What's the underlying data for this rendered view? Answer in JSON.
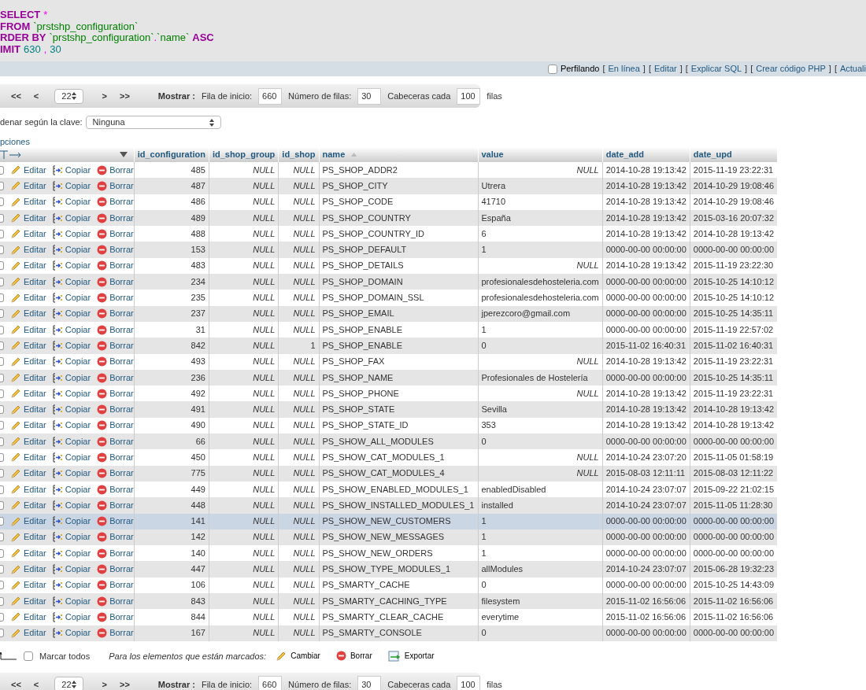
{
  "sql": {
    "lines": [
      [
        {
          "kind": "keyword",
          "text": "SELECT"
        },
        {
          "kind": "operator",
          "text": "*"
        }
      ],
      [
        {
          "kind": "keyword",
          "text": "FROM"
        },
        {
          "kind": "identifier",
          "text": "`prstshp_configuration`"
        }
      ],
      [
        {
          "kind": "keyword",
          "text": "RDER BY"
        },
        {
          "kind": "identifier",
          "text": "`prstshp_configuration`"
        },
        {
          "kind": "punct",
          "text": "."
        },
        {
          "kind": "identifier",
          "text": "`name`"
        },
        {
          "kind": "keyword",
          "text": "ASC"
        }
      ],
      [
        {
          "kind": "keyword",
          "text": "IMIT"
        },
        {
          "kind": "number",
          "text": "630"
        },
        {
          "kind": "operator",
          "text": ","
        },
        {
          "kind": "number",
          "text": "30"
        }
      ]
    ]
  },
  "profiling": {
    "checked": false,
    "label": "Perfilando",
    "bracket_open": "[",
    "bracket_close": "]",
    "links": [
      {
        "label": "En línea"
      },
      {
        "label": "Editar"
      },
      {
        "label": "Explicar SQL"
      },
      {
        "label": "Crear código PHP"
      },
      {
        "label": "Actuali"
      }
    ]
  },
  "nav_top": {
    "first": "<<",
    "prev": "<",
    "page": "22",
    "next": ">",
    "last": ">>",
    "show_label": "Mostrar :",
    "start_label": "Fila de inicio:",
    "start": "660",
    "rows_label": "Número de filas:",
    "rows": "30",
    "headers_label": "Cabeceras cada",
    "headers": "100",
    "suffix": "filas"
  },
  "sort": {
    "label": "denar según la clave:",
    "value": "Ninguna"
  },
  "options_link": "pciones",
  "columns": [
    {
      "label": "id_configuration",
      "sorted": false
    },
    {
      "label": "id_shop_group",
      "sorted": false
    },
    {
      "label": "id_shop",
      "sorted": false
    },
    {
      "label": "name",
      "sorted": true
    },
    {
      "label": "value",
      "sorted": false
    },
    {
      "label": "date_add",
      "sorted": false
    },
    {
      "label": "date_upd",
      "sorted": false
    }
  ],
  "rows": [
    {
      "checked": false,
      "highlighted": false,
      "actions": [
        "Editar",
        "Copiar",
        "Borrar"
      ],
      "cells": [
        "485",
        "NULL",
        "NULL",
        "PS_SHOP_ADDR2",
        "NULL",
        "2014-10-28 19:13:42",
        "2015-11-19 23:22:31"
      ],
      "null_cells": [
        false,
        true,
        true,
        false,
        true,
        false,
        false
      ]
    },
    {
      "checked": false,
      "highlighted": false,
      "actions": [
        "Editar",
        "Copiar",
        "Borrar"
      ],
      "cells": [
        "487",
        "NULL",
        "NULL",
        "PS_SHOP_CITY",
        "Utrera",
        "2014-10-28 19:13:42",
        "2014-10-29 19:08:46"
      ],
      "null_cells": [
        false,
        true,
        true,
        false,
        false,
        false,
        false
      ]
    },
    {
      "checked": false,
      "highlighted": false,
      "actions": [
        "Editar",
        "Copiar",
        "Borrar"
      ],
      "cells": [
        "486",
        "NULL",
        "NULL",
        "PS_SHOP_CODE",
        "41710",
        "2014-10-28 19:13:42",
        "2014-10-29 19:08:46"
      ],
      "null_cells": [
        false,
        true,
        true,
        false,
        false,
        false,
        false
      ]
    },
    {
      "checked": false,
      "highlighted": false,
      "actions": [
        "Editar",
        "Copiar",
        "Borrar"
      ],
      "cells": [
        "489",
        "NULL",
        "NULL",
        "PS_SHOP_COUNTRY",
        "España",
        "2014-10-28 19:13:42",
        "2015-03-16 20:07:32"
      ],
      "null_cells": [
        false,
        true,
        true,
        false,
        false,
        false,
        false
      ]
    },
    {
      "checked": false,
      "highlighted": false,
      "actions": [
        "Editar",
        "Copiar",
        "Borrar"
      ],
      "cells": [
        "488",
        "NULL",
        "NULL",
        "PS_SHOP_COUNTRY_ID",
        "6",
        "2014-10-28 19:13:42",
        "2014-10-28 19:13:42"
      ],
      "null_cells": [
        false,
        true,
        true,
        false,
        false,
        false,
        false
      ]
    },
    {
      "checked": false,
      "highlighted": false,
      "actions": [
        "Editar",
        "Copiar",
        "Borrar"
      ],
      "cells": [
        "153",
        "NULL",
        "NULL",
        "PS_SHOP_DEFAULT",
        "1",
        "0000-00-00 00:00:00",
        "0000-00-00 00:00:00"
      ],
      "null_cells": [
        false,
        true,
        true,
        false,
        false,
        false,
        false
      ]
    },
    {
      "checked": false,
      "highlighted": false,
      "actions": [
        "Editar",
        "Copiar",
        "Borrar"
      ],
      "cells": [
        "483",
        "NULL",
        "NULL",
        "PS_SHOP_DETAILS",
        "NULL",
        "2014-10-28 19:13:42",
        "2015-11-19 23:22:30"
      ],
      "null_cells": [
        false,
        true,
        true,
        false,
        true,
        false,
        false
      ]
    },
    {
      "checked": false,
      "highlighted": false,
      "actions": [
        "Editar",
        "Copiar",
        "Borrar"
      ],
      "cells": [
        "234",
        "NULL",
        "NULL",
        "PS_SHOP_DOMAIN",
        "profesionalesdehosteleria.com",
        "0000-00-00 00:00:00",
        "2015-10-25 14:10:12"
      ],
      "null_cells": [
        false,
        true,
        true,
        false,
        false,
        false,
        false
      ]
    },
    {
      "checked": false,
      "highlighted": false,
      "actions": [
        "Editar",
        "Copiar",
        "Borrar"
      ],
      "cells": [
        "235",
        "NULL",
        "NULL",
        "PS_SHOP_DOMAIN_SSL",
        "profesionalesdehosteleria.com",
        "0000-00-00 00:00:00",
        "2015-10-25 14:10:12"
      ],
      "null_cells": [
        false,
        true,
        true,
        false,
        false,
        false,
        false
      ]
    },
    {
      "checked": false,
      "highlighted": false,
      "actions": [
        "Editar",
        "Copiar",
        "Borrar"
      ],
      "cells": [
        "237",
        "NULL",
        "NULL",
        "PS_SHOP_EMAIL",
        "jperezcoro@gmail.com",
        "0000-00-00 00:00:00",
        "2015-10-25 14:35:11"
      ],
      "null_cells": [
        false,
        true,
        true,
        false,
        false,
        false,
        false
      ]
    },
    {
      "checked": false,
      "highlighted": false,
      "actions": [
        "Editar",
        "Copiar",
        "Borrar"
      ],
      "cells": [
        "31",
        "NULL",
        "NULL",
        "PS_SHOP_ENABLE",
        "1",
        "0000-00-00 00:00:00",
        "2015-11-19 22:57:02"
      ],
      "null_cells": [
        false,
        true,
        true,
        false,
        false,
        false,
        false
      ]
    },
    {
      "checked": false,
      "highlighted": false,
      "actions": [
        "Editar",
        "Copiar",
        "Borrar"
      ],
      "cells": [
        "842",
        "NULL",
        "1",
        "PS_SHOP_ENABLE",
        "0",
        "2015-11-02 16:40:31",
        "2015-11-02 16:40:31"
      ],
      "null_cells": [
        false,
        true,
        false,
        false,
        false,
        false,
        false
      ]
    },
    {
      "checked": false,
      "highlighted": false,
      "actions": [
        "Editar",
        "Copiar",
        "Borrar"
      ],
      "cells": [
        "493",
        "NULL",
        "NULL",
        "PS_SHOP_FAX",
        "NULL",
        "2014-10-28 19:13:42",
        "2015-11-19 23:22:31"
      ],
      "null_cells": [
        false,
        true,
        true,
        false,
        true,
        false,
        false
      ]
    },
    {
      "checked": false,
      "highlighted": false,
      "actions": [
        "Editar",
        "Copiar",
        "Borrar"
      ],
      "cells": [
        "236",
        "NULL",
        "NULL",
        "PS_SHOP_NAME",
        "Profesionales de Hostelería",
        "0000-00-00 00:00:00",
        "2015-10-25 14:35:11"
      ],
      "null_cells": [
        false,
        true,
        true,
        false,
        false,
        false,
        false
      ]
    },
    {
      "checked": false,
      "highlighted": false,
      "actions": [
        "Editar",
        "Copiar",
        "Borrar"
      ],
      "cells": [
        "492",
        "NULL",
        "NULL",
        "PS_SHOP_PHONE",
        "NULL",
        "2014-10-28 19:13:42",
        "2015-11-19 23:22:31"
      ],
      "null_cells": [
        false,
        true,
        true,
        false,
        true,
        false,
        false
      ]
    },
    {
      "checked": false,
      "highlighted": false,
      "actions": [
        "Editar",
        "Copiar",
        "Borrar"
      ],
      "cells": [
        "491",
        "NULL",
        "NULL",
        "PS_SHOP_STATE",
        "Sevilla",
        "2014-10-28 19:13:42",
        "2014-10-28 19:13:42"
      ],
      "null_cells": [
        false,
        true,
        true,
        false,
        false,
        false,
        false
      ]
    },
    {
      "checked": false,
      "highlighted": false,
      "actions": [
        "Editar",
        "Copiar",
        "Borrar"
      ],
      "cells": [
        "490",
        "NULL",
        "NULL",
        "PS_SHOP_STATE_ID",
        "353",
        "2014-10-28 19:13:42",
        "2014-10-28 19:13:42"
      ],
      "null_cells": [
        false,
        true,
        true,
        false,
        false,
        false,
        false
      ]
    },
    {
      "checked": false,
      "highlighted": false,
      "actions": [
        "Editar",
        "Copiar",
        "Borrar"
      ],
      "cells": [
        "66",
        "NULL",
        "NULL",
        "PS_SHOW_ALL_MODULES",
        "0",
        "0000-00-00 00:00:00",
        "0000-00-00 00:00:00"
      ],
      "null_cells": [
        false,
        true,
        true,
        false,
        false,
        false,
        false
      ]
    },
    {
      "checked": false,
      "highlighted": false,
      "actions": [
        "Editar",
        "Copiar",
        "Borrar"
      ],
      "cells": [
        "450",
        "NULL",
        "NULL",
        "PS_SHOW_CAT_MODULES_1",
        "NULL",
        "2014-10-24 23:07:20",
        "2015-11-05 01:58:19"
      ],
      "null_cells": [
        false,
        true,
        true,
        false,
        true,
        false,
        false
      ]
    },
    {
      "checked": false,
      "highlighted": false,
      "actions": [
        "Editar",
        "Copiar",
        "Borrar"
      ],
      "cells": [
        "775",
        "NULL",
        "NULL",
        "PS_SHOW_CAT_MODULES_4",
        "NULL",
        "2015-08-03 12:11:11",
        "2015-08-03 12:11:22"
      ],
      "null_cells": [
        false,
        true,
        true,
        false,
        true,
        false,
        false
      ]
    },
    {
      "checked": false,
      "highlighted": false,
      "actions": [
        "Editar",
        "Copiar",
        "Borrar"
      ],
      "cells": [
        "449",
        "NULL",
        "NULL",
        "PS_SHOW_ENABLED_MODULES_1",
        "enabledDisabled",
        "2014-10-24 23:07:07",
        "2015-09-22 21:02:15"
      ],
      "null_cells": [
        false,
        true,
        true,
        false,
        false,
        false,
        false
      ]
    },
    {
      "checked": false,
      "highlighted": false,
      "actions": [
        "Editar",
        "Copiar",
        "Borrar"
      ],
      "cells": [
        "448",
        "NULL",
        "NULL",
        "PS_SHOW_INSTALLED_MODULES_1",
        "installed",
        "2014-10-24 23:07:07",
        "2015-11-05 11:28:30"
      ],
      "null_cells": [
        false,
        true,
        true,
        false,
        false,
        false,
        false
      ]
    },
    {
      "checked": false,
      "highlighted": true,
      "actions": [
        "Editar",
        "Copiar",
        "Borrar"
      ],
      "cells": [
        "141",
        "NULL",
        "NULL",
        "PS_SHOW_NEW_CUSTOMERS",
        "1",
        "0000-00-00 00:00:00",
        "0000-00-00 00:00:00"
      ],
      "null_cells": [
        false,
        true,
        true,
        false,
        false,
        false,
        false
      ]
    },
    {
      "checked": false,
      "highlighted": false,
      "actions": [
        "Editar",
        "Copiar",
        "Borrar"
      ],
      "cells": [
        "142",
        "NULL",
        "NULL",
        "PS_SHOW_NEW_MESSAGES",
        "1",
        "0000-00-00 00:00:00",
        "0000-00-00 00:00:00"
      ],
      "null_cells": [
        false,
        true,
        true,
        false,
        false,
        false,
        false
      ]
    },
    {
      "checked": false,
      "highlighted": false,
      "actions": [
        "Editar",
        "Copiar",
        "Borrar"
      ],
      "cells": [
        "140",
        "NULL",
        "NULL",
        "PS_SHOW_NEW_ORDERS",
        "1",
        "0000-00-00 00:00:00",
        "0000-00-00 00:00:00"
      ],
      "null_cells": [
        false,
        true,
        true,
        false,
        false,
        false,
        false
      ]
    },
    {
      "checked": false,
      "highlighted": false,
      "actions": [
        "Editar",
        "Copiar",
        "Borrar"
      ],
      "cells": [
        "447",
        "NULL",
        "NULL",
        "PS_SHOW_TYPE_MODULES_1",
        "allModules",
        "2014-10-24 23:07:07",
        "2015-06-28 19:32:23"
      ],
      "null_cells": [
        false,
        true,
        true,
        false,
        false,
        false,
        false
      ]
    },
    {
      "checked": false,
      "highlighted": false,
      "actions": [
        "Editar",
        "Copiar",
        "Borrar"
      ],
      "cells": [
        "106",
        "NULL",
        "NULL",
        "PS_SMARTY_CACHE",
        "0",
        "0000-00-00 00:00:00",
        "2015-10-25 14:43:09"
      ],
      "null_cells": [
        false,
        true,
        true,
        false,
        false,
        false,
        false
      ]
    },
    {
      "checked": false,
      "highlighted": false,
      "actions": [
        "Editar",
        "Copiar",
        "Borrar"
      ],
      "cells": [
        "843",
        "NULL",
        "NULL",
        "PS_SMARTY_CACHING_TYPE",
        "filesystem",
        "2015-11-02 16:56:06",
        "2015-11-02 16:56:06"
      ],
      "null_cells": [
        false,
        true,
        true,
        false,
        false,
        false,
        false
      ]
    },
    {
      "checked": false,
      "highlighted": false,
      "actions": [
        "Editar",
        "Copiar",
        "Borrar"
      ],
      "cells": [
        "844",
        "NULL",
        "NULL",
        "PS_SMARTY_CLEAR_CACHE",
        "everytime",
        "2015-11-02 16:56:06",
        "2015-11-02 16:56:06"
      ],
      "null_cells": [
        false,
        true,
        true,
        false,
        false,
        false,
        false
      ]
    },
    {
      "checked": false,
      "highlighted": false,
      "actions": [
        "Editar",
        "Copiar",
        "Borrar"
      ],
      "cells": [
        "167",
        "NULL",
        "NULL",
        "PS_SMARTY_CONSOLE",
        "0",
        "0000-00-00 00:00:00",
        "0000-00-00 00:00:00"
      ],
      "null_cells": [
        false,
        true,
        true,
        false,
        false,
        false,
        false
      ]
    }
  ],
  "footer": {
    "check_all": {
      "label": "Marcar todos",
      "checked": false
    },
    "with_selected": "Para los elementos que están marcados:",
    "actions": [
      "Cambiar",
      "Borrar",
      "Exportar"
    ]
  },
  "nav_bottom": {
    "first": "<<",
    "prev": "<",
    "page": "22",
    "next": ">",
    "last": ">>",
    "show_label": "Mostrar :",
    "start_label": "Fila de inicio:",
    "start": "660",
    "rows_label": "Número de filas:",
    "rows": "30",
    "headers_label": "Cabeceras cada",
    "headers": "100",
    "suffix": "filas"
  }
}
